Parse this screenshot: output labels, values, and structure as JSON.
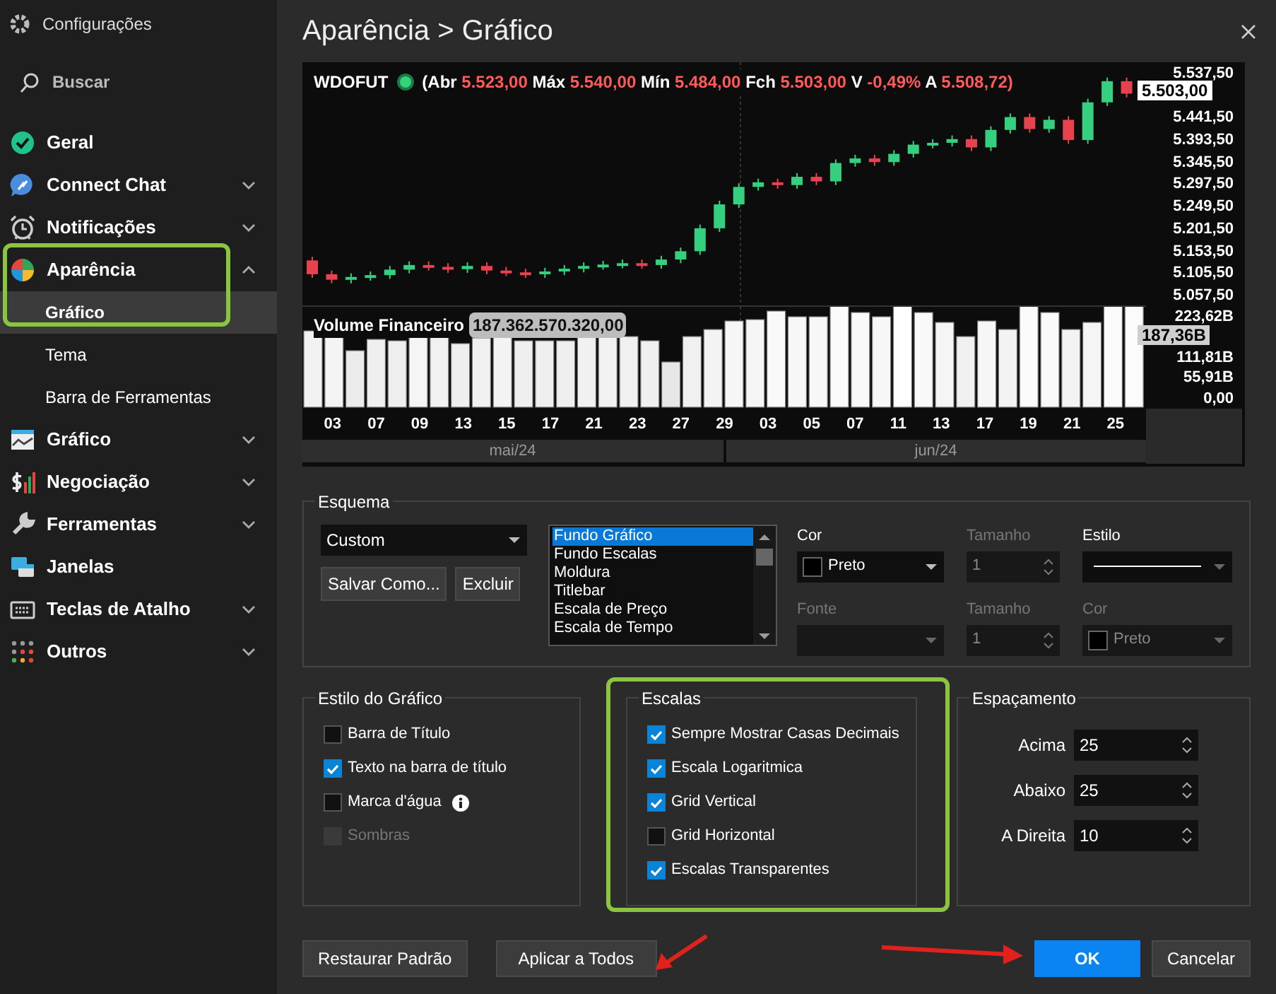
{
  "sidebar": {
    "title": "Configurações",
    "search": {
      "label": "Buscar"
    },
    "items": [
      {
        "label": "Geral",
        "kind": "link",
        "selected": false
      },
      {
        "label": "Connect Chat",
        "kind": "group",
        "expanded": false,
        "selected": false
      },
      {
        "label": "Notificações",
        "kind": "group",
        "expanded": false,
        "selected": false
      },
      {
        "label": "Aparência",
        "kind": "group",
        "expanded": true,
        "selected": false,
        "children": [
          {
            "label": "Gráfico",
            "selected": true
          },
          {
            "label": "Tema",
            "selected": false
          },
          {
            "label": "Barra de Ferramentas",
            "selected": false
          }
        ]
      },
      {
        "label": "Gráfico",
        "kind": "group",
        "expanded": false,
        "selected": false
      },
      {
        "label": "Negociação",
        "kind": "group",
        "expanded": false,
        "selected": false
      },
      {
        "label": "Ferramentas",
        "kind": "group",
        "expanded": false,
        "selected": false
      },
      {
        "label": "Janelas",
        "kind": "link",
        "selected": false
      },
      {
        "label": "Teclas de Atalho",
        "kind": "group",
        "expanded": false,
        "selected": false
      },
      {
        "label": "Outros",
        "kind": "group",
        "expanded": false,
        "selected": false
      }
    ]
  },
  "page": {
    "title": "Aparência > Gráfico"
  },
  "chart": {
    "symbol": "WDOFUT",
    "quote": [
      {
        "label": "(Abr",
        "value": "5.523,00"
      },
      {
        "label": "Máx",
        "value": "5.540,00"
      },
      {
        "label": "Mín",
        "value": "5.484,00"
      },
      {
        "label": "Fch",
        "value": "5.503,00"
      },
      {
        "label": "V",
        "value": "-0,49%"
      },
      {
        "label": "A",
        "value": "5.508,72)"
      }
    ],
    "price_ticks": [
      "5.537,50",
      "5.441,50",
      "5.393,50",
      "5.345,50",
      "5.297,50",
      "5.249,50",
      "5.201,50",
      "5.153,50",
      "5.105,50",
      "5.057,50"
    ],
    "last_price": "5.503,00",
    "volume_title": "Volume Financeiro",
    "volume_value": "187.362.570.320,00",
    "volume_ticks": [
      "223,62B",
      "111,81B",
      "55,91B",
      "0,00"
    ],
    "last_volume": "187,36B",
    "date_ticks": [
      "03",
      "07",
      "09",
      "13",
      "15",
      "17",
      "21",
      "23",
      "27",
      "29",
      "03",
      "05",
      "07",
      "11",
      "13",
      "17",
      "19",
      "21",
      "25"
    ],
    "months": [
      "mai/24",
      "jun/24"
    ]
  },
  "scheme": {
    "title": "Esquema",
    "preset": "Custom",
    "buttons": [
      "Salvar Como...",
      "Excluir"
    ],
    "elements": [
      {
        "label": "Fundo Gráfico",
        "selected": true
      },
      {
        "label": "Fundo Escalas",
        "selected": false
      },
      {
        "label": "Moldura",
        "selected": false
      },
      {
        "label": "Titlebar",
        "selected": false
      },
      {
        "label": "Escala de Preço",
        "selected": false
      },
      {
        "label": "Escala de Tempo",
        "selected": false
      }
    ],
    "fields": [
      {
        "label": "Cor",
        "kind": "color",
        "value": "Preto",
        "disabled": false
      },
      {
        "label": "Tamanho",
        "kind": "spin",
        "value": "1",
        "disabled": true
      },
      {
        "label": "Estilo",
        "kind": "line",
        "disabled": false
      },
      {
        "label": "Fonte",
        "kind": "select",
        "disabled": true
      },
      {
        "label": "Tamanho",
        "kind": "spin",
        "value": "1",
        "disabled": true
      },
      {
        "label": "Cor",
        "kind": "color",
        "value": "Preto",
        "disabled": true
      }
    ]
  },
  "chart_style": {
    "title": "Estilo do Gráfico",
    "options": [
      {
        "label": "Barra de Título",
        "checked": false,
        "disabled": false,
        "info": false
      },
      {
        "label": "Texto na barra de título",
        "checked": true,
        "disabled": false,
        "info": false
      },
      {
        "label": "Marca d'água",
        "checked": false,
        "disabled": false,
        "info": true
      },
      {
        "label": "Sombras",
        "checked": false,
        "disabled": true,
        "info": false
      }
    ]
  },
  "scales": {
    "title": "Escalas",
    "options": [
      {
        "label": "Sempre Mostrar Casas Decimais",
        "checked": true
      },
      {
        "label": "Escala Logaritmica",
        "checked": true
      },
      {
        "label": "Grid Vertical",
        "checked": true
      },
      {
        "label": "Grid Horizontal",
        "checked": false
      },
      {
        "label": "Escalas Transparentes",
        "checked": true
      }
    ]
  },
  "spacing": {
    "title": "Espaçamento",
    "fields": [
      {
        "label": "Acima",
        "value": "25"
      },
      {
        "label": "Abaixo",
        "value": "25"
      },
      {
        "label": "A Direita",
        "value": "10"
      }
    ]
  },
  "buttons": [
    {
      "label": "Restaurar Padrão",
      "primary": false
    },
    {
      "label": "Aplicar a Todos",
      "primary": false
    },
    {
      "label": "OK",
      "primary": true
    },
    {
      "label": "Cancelar",
      "primary": false
    }
  ]
}
